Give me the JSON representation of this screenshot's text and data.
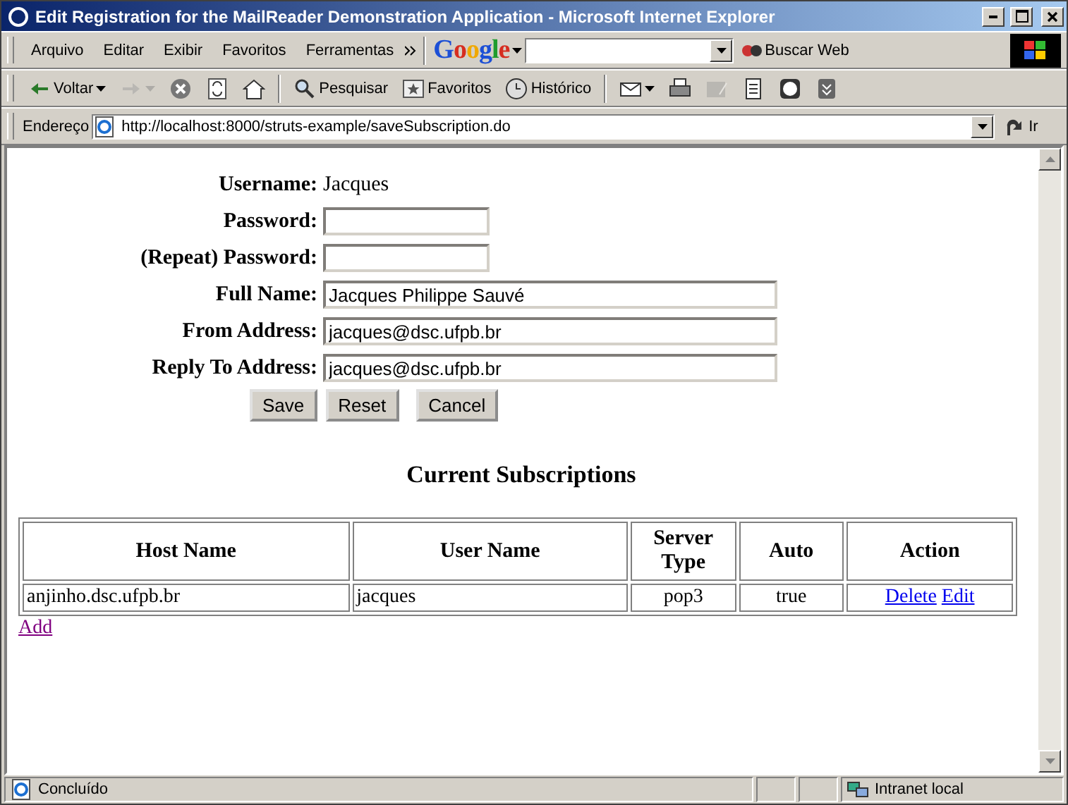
{
  "window": {
    "title": "Edit Registration for the MailReader Demonstration Application - Microsoft Internet Explorer"
  },
  "menu": [
    "Arquivo",
    "Editar",
    "Exibir",
    "Favoritos",
    "Ferramentas"
  ],
  "google_toolbar": {
    "logo": "Google",
    "search_button": "Buscar Web"
  },
  "nav_toolbar": [
    {
      "kind": "back",
      "label": "Voltar",
      "disabled": false
    },
    {
      "kind": "forward",
      "disabled": true
    },
    {
      "kind": "stop",
      "disabled": false
    },
    {
      "kind": "refresh",
      "disabled": false
    },
    {
      "kind": "home",
      "disabled": false
    },
    {
      "kind": "search",
      "label": "Pesquisar",
      "disabled": false
    },
    {
      "kind": "favorites",
      "label": "Favoritos",
      "disabled": false
    },
    {
      "kind": "history",
      "label": "Histórico",
      "disabled": false
    },
    {
      "kind": "mail",
      "disabled": false
    },
    {
      "kind": "print",
      "disabled": false
    },
    {
      "kind": "edit",
      "disabled": true
    },
    {
      "kind": "discuss",
      "disabled": false
    },
    {
      "kind": "spy",
      "disabled": false
    },
    {
      "kind": "messenger",
      "disabled": false
    }
  ],
  "address_bar": {
    "label": "Endereço",
    "url": "http://localhost:8000/struts-example/saveSubscription.do",
    "go": "Ir"
  },
  "form": {
    "fields": [
      {
        "kind": "text",
        "label": "Username:",
        "value": "Jacques"
      },
      {
        "kind": "password",
        "label": "Password:"
      },
      {
        "kind": "password",
        "label": "(Repeat) Password:"
      },
      {
        "kind": "input",
        "label": "Full Name:",
        "value": "Jacques Philippe Sauvé"
      },
      {
        "kind": "input",
        "label": "From Address:",
        "value": "jacques@dsc.ufpb.br"
      },
      {
        "kind": "input",
        "label": "Reply To Address:",
        "value": "jacques@dsc.ufpb.br"
      }
    ],
    "buttons": [
      "Save",
      "Reset",
      "Cancel"
    ]
  },
  "subscriptions": {
    "heading": "Current Subscriptions",
    "columns": [
      "Host Name",
      "User Name",
      "Server Type",
      "Auto",
      "Action"
    ],
    "rows": [
      {
        "cells": [
          "anjinho.dsc.ufpb.br",
          "jacques",
          "pop3",
          "true"
        ],
        "actions": [
          {
            "label": "Delete",
            "visited": false
          },
          {
            "label": "Edit",
            "visited": false
          }
        ]
      }
    ],
    "add_link": {
      "label": "Add",
      "visited": true
    }
  },
  "status_bar": {
    "text": "Concluído",
    "zone": "Intranet local"
  }
}
